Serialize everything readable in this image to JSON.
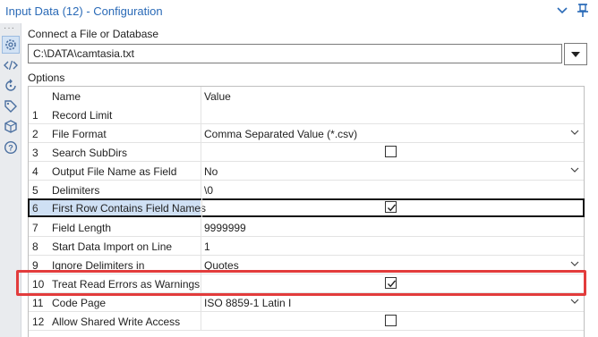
{
  "window": {
    "title": "Input Data (12) - Configuration"
  },
  "connect": {
    "label": "Connect a File or Database",
    "file_value": "C:\\DATA\\camtasia.txt"
  },
  "options": {
    "label": "Options",
    "columns": {
      "name": "Name",
      "value": "Value"
    },
    "rows": [
      {
        "num": "1",
        "name": "Record Limit",
        "value": ""
      },
      {
        "num": "2",
        "name": "File Format",
        "value": "Comma Separated Value (*.csv)"
      },
      {
        "num": "3",
        "name": "Search SubDirs",
        "value": ""
      },
      {
        "num": "4",
        "name": "Output File Name as Field",
        "value": "No"
      },
      {
        "num": "5",
        "name": "Delimiters",
        "value": "\\0"
      },
      {
        "num": "6",
        "name": "First Row Contains Field Names",
        "value": ""
      },
      {
        "num": "7",
        "name": "Field Length",
        "value": "9999999"
      },
      {
        "num": "8",
        "name": "Start Data Import on Line",
        "value": "1"
      },
      {
        "num": "9",
        "name": "Ignore Delimiters in",
        "value": "Quotes"
      },
      {
        "num": "10",
        "name": "Treat Read Errors as Warnings",
        "value": ""
      },
      {
        "num": "11",
        "name": "Code Page",
        "value": "ISO 8859-1 Latin I"
      },
      {
        "num": "12",
        "name": "Allow Shared Write Access",
        "value": ""
      }
    ],
    "checkboxes": {
      "row3": false,
      "row6": true,
      "row10": true,
      "row12": false
    }
  },
  "sidebar": {
    "icons": [
      "gear-icon",
      "code-icon",
      "refresh-icon",
      "tag-icon",
      "cube-icon",
      "help-icon"
    ]
  },
  "colors": {
    "title": "#2a6ab7",
    "selection": "#cfe0f4",
    "highlight_box": "#e23c3c"
  }
}
